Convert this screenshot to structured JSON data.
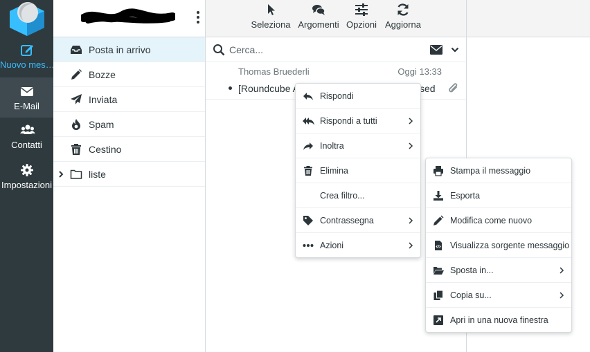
{
  "rail": {
    "compose_label": "Nuovo mes…",
    "mail_label": "E-Mail",
    "contacts_label": "Contatti",
    "settings_label": "Impostazioni"
  },
  "folders": [
    {
      "name": "Posta in arrivo",
      "icon": "inbox-icon",
      "selected": true
    },
    {
      "name": "Bozze",
      "icon": "pencil-icon"
    },
    {
      "name": "Inviata",
      "icon": "paper-plane-icon"
    },
    {
      "name": "Spam",
      "icon": "fire-icon"
    },
    {
      "name": "Cestino",
      "icon": "trash-icon"
    },
    {
      "name": "liste",
      "icon": "folder-icon",
      "collapsed": true
    }
  ],
  "toolbar": {
    "select_label": "Seleziona",
    "threads_label": "Argomenti",
    "options_label": "Opzioni",
    "refresh_label": "Aggiorna"
  },
  "search": {
    "placeholder": "Cerca..."
  },
  "message": {
    "from": "Thomas Bruederli",
    "date": "Oggi 13:33",
    "subject": "[Roundcube A",
    "subject_tail": "sed",
    "has_attachment": true
  },
  "context_menu": [
    {
      "label": "Rispondi",
      "icon": "reply-icon"
    },
    {
      "label": "Rispondi a tutti",
      "icon": "reply-all-icon",
      "submenu": true
    },
    {
      "label": "Inoltra",
      "icon": "forward-icon",
      "submenu": true
    },
    {
      "label": "Elimina",
      "icon": "trash-icon"
    },
    {
      "label": "Crea filtro...",
      "icon": ""
    },
    {
      "label": "Contrassegna",
      "icon": "tag-icon",
      "submenu": true
    },
    {
      "label": "Azioni",
      "icon": "ellipsis-icon",
      "submenu": true
    }
  ],
  "actions_menu": [
    {
      "label": "Stampa il messaggio",
      "icon": "print-icon"
    },
    {
      "label": "Esporta",
      "icon": "download-icon"
    },
    {
      "label": "Modifica come nuovo",
      "icon": "pencil-icon"
    },
    {
      "label": "Visualizza sorgente messaggio",
      "icon": "source-code-icon"
    },
    {
      "label": "Sposta in...",
      "icon": "folder-open-icon",
      "submenu": true
    },
    {
      "label": "Copia su...",
      "icon": "copy-icon",
      "submenu": true
    },
    {
      "label": "Apri in una nuova finestra",
      "icon": "external-window-icon"
    }
  ],
  "colors": {
    "rail_bg": "#2f3a3f",
    "accent": "#37beff",
    "selected_bg": "#e5f4fb",
    "logo_blue": "#37beff"
  }
}
